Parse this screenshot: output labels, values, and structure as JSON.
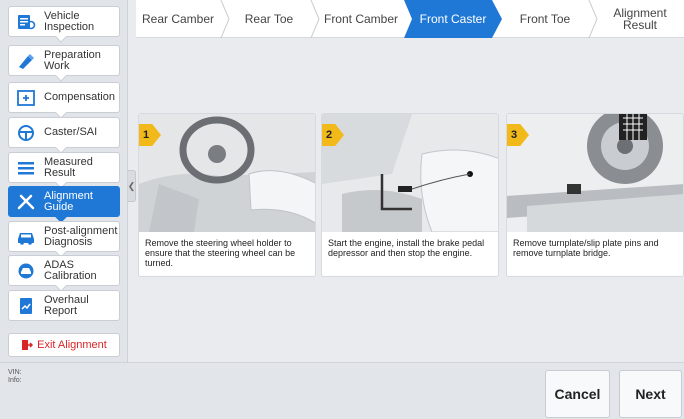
{
  "sidebar": {
    "items": [
      {
        "label": "Vehicle Inspection",
        "icon": "vehicle-inspection-icon"
      },
      {
        "label": "Preparation Work",
        "icon": "preparation-icon"
      },
      {
        "label": "Compensation",
        "icon": "compensation-icon"
      },
      {
        "label": "Caster/SAI",
        "icon": "steering-wheel-icon"
      },
      {
        "label": "Measured Result",
        "icon": "list-icon"
      },
      {
        "label": "Alignment Guide",
        "icon": "tools-icon",
        "active": true
      },
      {
        "label": "Post-alignment Diagnosis",
        "icon": "car-icon"
      },
      {
        "label": "ADAS Calibration",
        "icon": "adas-icon"
      },
      {
        "label": "Overhaul Report",
        "icon": "report-icon"
      }
    ],
    "exit_label": "Exit Alignment"
  },
  "tabs": [
    {
      "label": "Rear Camber"
    },
    {
      "label": "Rear Toe"
    },
    {
      "label": "Front Camber"
    },
    {
      "label": "Front Caster",
      "active": true
    },
    {
      "label": "Front Toe"
    },
    {
      "label": "Alignment Result"
    }
  ],
  "steps": [
    {
      "number": "1",
      "text": "Remove the steering wheel holder to ensure that the steering wheel can be turned."
    },
    {
      "number": "2",
      "text": "Start the engine, install the brake pedal depressor and then stop the engine."
    },
    {
      "number": "3",
      "text": "Remove turnplate/slip plate pins and remove turnplate bridge."
    }
  ],
  "footer": {
    "vin_label": "VIN:",
    "info_label": "Info:",
    "cancel_label": "Cancel",
    "next_label": "Next"
  },
  "colors": {
    "accent": "#1f78d6",
    "exit": "#d92525",
    "step_badge": "#f2b91a"
  }
}
